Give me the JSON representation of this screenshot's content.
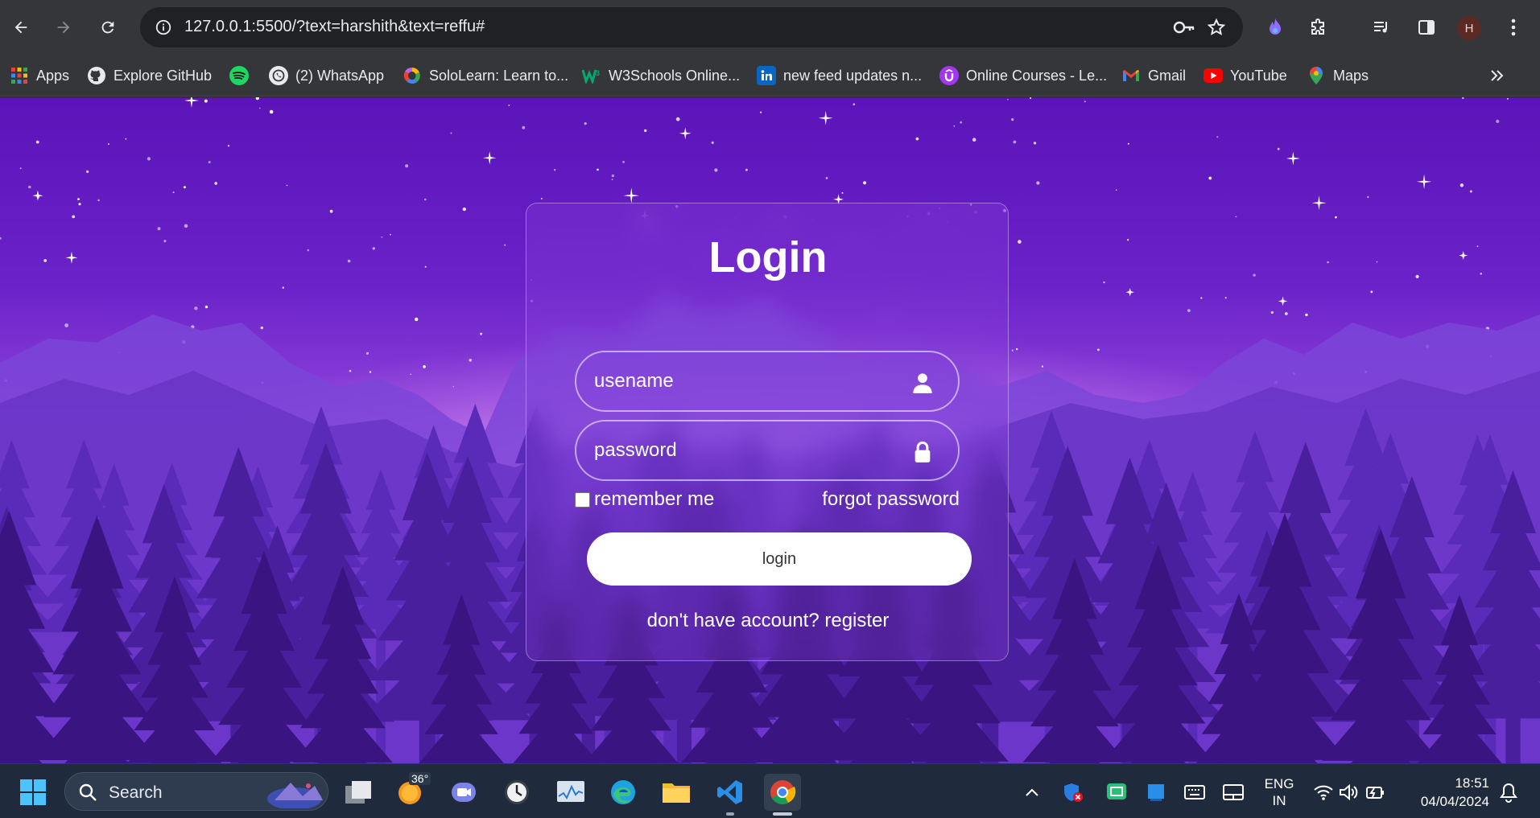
{
  "browser": {
    "url": "127.0.0.1:5500/?text=harshith&text=reffu#",
    "profile_initial": "H",
    "bookmarks": [
      {
        "label": "Apps",
        "icon": "apps-grid-icon"
      },
      {
        "label": "Explore GitHub",
        "icon": "github-icon"
      },
      {
        "label": "",
        "icon": "spotify-icon"
      },
      {
        "label": "(2) WhatsApp",
        "icon": "whatsapp-icon"
      },
      {
        "label": "SoloLearn: Learn to...",
        "icon": "sololearn-icon"
      },
      {
        "label": "W3Schools Online...",
        "icon": "w3schools-icon"
      },
      {
        "label": "new feed updates n...",
        "icon": "linkedin-icon"
      },
      {
        "label": "Online Courses - Le...",
        "icon": "udemy-icon"
      },
      {
        "label": "Gmail",
        "icon": "gmail-icon"
      },
      {
        "label": "YouTube",
        "icon": "youtube-icon"
      },
      {
        "label": "Maps",
        "icon": "maps-icon"
      }
    ]
  },
  "login": {
    "title": "Login",
    "username_placeholder": "usename",
    "password_placeholder": "password",
    "remember_label": "remember me",
    "forgot_label": "forgot password",
    "login_button": "login",
    "register_text": "don't have account? register"
  },
  "taskbar": {
    "search_label": "Search",
    "weather_temp": "36°",
    "language_line1": "ENG",
    "language_line2": "IN",
    "time": "18:51",
    "date": "04/04/2024"
  },
  "colors": {
    "sky_top": "#5b14b8",
    "horizon_glow": "#c97bea",
    "taskbar_bg": "#1f2b3c",
    "chrome_bg": "#35363a"
  }
}
